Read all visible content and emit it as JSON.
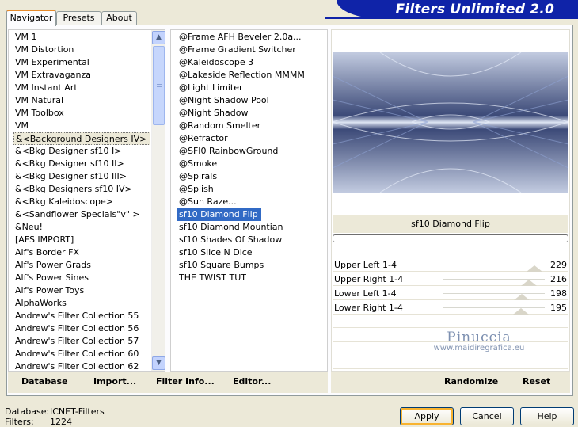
{
  "tabs": [
    "Navigator",
    "Presets",
    "About"
  ],
  "banner_title": "Filters Unlimited 2.0",
  "categories": [
    "VM 1",
    "VM Distortion",
    "VM Experimental",
    "VM Extravaganza",
    "VM Instant Art",
    "VM Natural",
    "VM Toolbox",
    "VM",
    "&<Background Designers IV>",
    "&<Bkg Designer sf10 I>",
    "&<Bkg Designer sf10 II>",
    "&<Bkg Designer sf10 III>",
    "&<Bkg Designers sf10 IV>",
    "&<Bkg Kaleidoscope>",
    "&<Sandflower Specials\"v\" >",
    "&Neu!",
    "[AFS IMPORT]",
    "Alf's Border FX",
    "Alf's Power Grads",
    "Alf's Power Sines",
    "Alf's Power Toys",
    "AlphaWorks",
    "Andrew's Filter Collection 55",
    "Andrew's Filter Collection 56",
    "Andrew's Filter Collection 57",
    "Andrew's Filter Collection 60",
    "Andrew's Filter Collection 62"
  ],
  "selected_category": "&<Background Designers IV>",
  "filters": [
    "@Frame AFH Beveler 2.0a...",
    "@Frame Gradient Switcher",
    "@Kaleidoscope 3",
    "@Lakeside Reflection MMMM",
    "@Light Limiter",
    "@Night Shadow Pool",
    "@Night Shadow",
    "@Random Smelter",
    "@Refractor",
    "@SFI0 RainbowGround",
    "@Smoke",
    "@Spirals",
    "@Splish",
    "@Sun Raze...",
    "sf10 Diamond Flip",
    "sf10 Diamond Mountian",
    "sf10 Shades Of Shadow",
    "sf10 Slice N Dice",
    "sf10 Square Bumps",
    "THE TWIST TUT"
  ],
  "selected_filter": "sf10 Diamond Flip",
  "filter_name": "sf10 Diamond Flip",
  "params": [
    {
      "label": "Upper Left 1-4",
      "value": "229",
      "level": 0.898
    },
    {
      "label": "Upper Right 1-4",
      "value": "216",
      "level": 0.847
    },
    {
      "label": "Lower Left 1-4",
      "value": "198",
      "level": 0.776
    },
    {
      "label": "Lower Right 1-4",
      "value": "195",
      "level": 0.765
    }
  ],
  "watermark": {
    "name": "Pinuccia",
    "url": "www.maidiregrafica.eu"
  },
  "left_buttons": {
    "database": "Database",
    "import": "Import...",
    "filter_info": "Filter Info...",
    "editor": "Editor..."
  },
  "right_buttons": {
    "randomize": "Randomize",
    "reset": "Reset"
  },
  "dialog_buttons": {
    "apply": "Apply",
    "cancel": "Cancel",
    "help": "Help"
  },
  "status": {
    "database_label": "Database:",
    "database_value": "ICNET-Filters",
    "filters_label": "Filters:",
    "filters_value": "1224"
  },
  "colors": {
    "banner": "#0f23a8",
    "selection": "#316ac5",
    "tab_accent": "#e68b2c"
  }
}
